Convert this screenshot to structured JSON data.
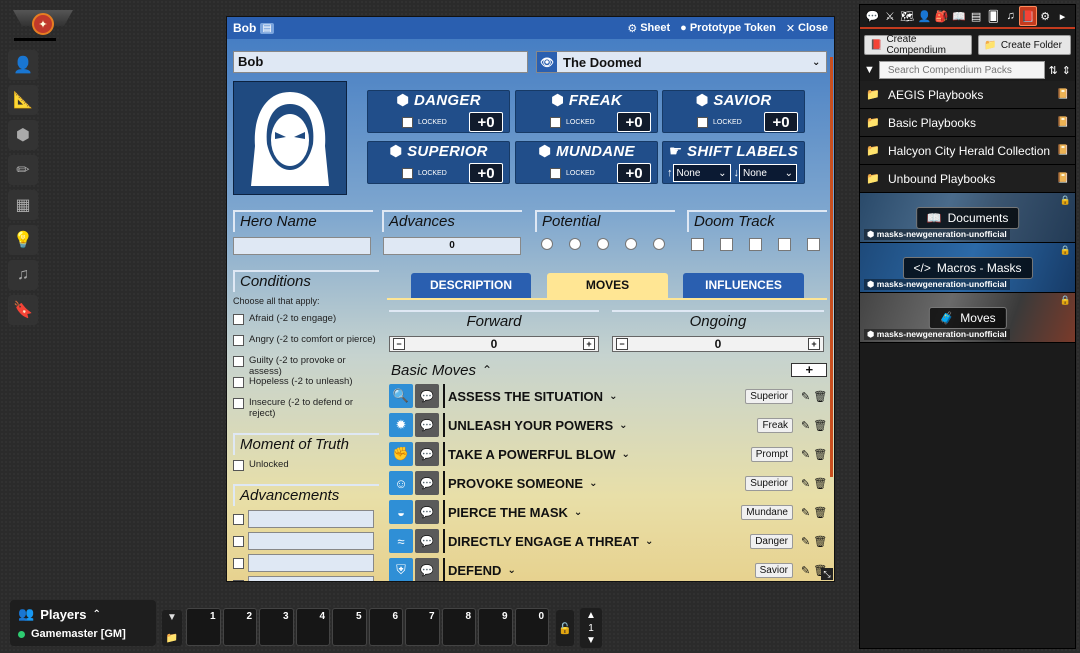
{
  "left_tools": [
    "token-controls",
    "measure",
    "tiles",
    "drawing",
    "walls",
    "lighting",
    "sounds",
    "notes"
  ],
  "players": {
    "title": "Players",
    "gm": "Gamemaster [GM]"
  },
  "hotbar": {
    "slots": [
      "1",
      "2",
      "3",
      "4",
      "5",
      "6",
      "7",
      "8",
      "9",
      "0"
    ],
    "page": "1"
  },
  "sheet": {
    "title": "Bob",
    "actions": {
      "sheet": "Sheet",
      "token": "Prototype Token",
      "close": "Close"
    },
    "name": "Bob",
    "playbook": "The Doomed",
    "stats": [
      {
        "name": "DANGER",
        "locked": "LOCKED",
        "value": "+0"
      },
      {
        "name": "FREAK",
        "locked": "LOCKED",
        "value": "+0"
      },
      {
        "name": "SAVIOR",
        "locked": "LOCKED",
        "value": "+0"
      },
      {
        "name": "SUPERIOR",
        "locked": "LOCKED",
        "value": "+0"
      },
      {
        "name": "MUNDANE",
        "locked": "LOCKED",
        "value": "+0"
      }
    ],
    "shift_labels": {
      "name": "SHIFT LABELS",
      "up": "None",
      "down": "None"
    },
    "hero_name_label": "Hero Name",
    "advances_label": "Advances",
    "advances_value": "0",
    "potential_label": "Potential",
    "doom_track_label": "Doom Track",
    "conditions_label": "Conditions",
    "conditions_sub": "Choose all that apply:",
    "conditions": [
      "Afraid (-2 to engage)",
      "Angry (-2 to comfort or pierce)",
      "Guilty (-2 to provoke or assess)",
      "Hopeless (-2 to unleash)",
      "Insecure (-2 to defend or reject)"
    ],
    "moment_label": "Moment of Truth",
    "moment_unlocked": "Unlocked",
    "advancements_label": "Advancements",
    "tabs": [
      "DESCRIPTION",
      "MOVES",
      "INFLUENCES"
    ],
    "forward_label": "Forward",
    "forward_value": "0",
    "ongoing_label": "Ongoing",
    "ongoing_value": "0",
    "basic_moves_label": "Basic Moves",
    "add_label": "+",
    "moves": [
      {
        "name": "ASSESS THE SITUATION",
        "tag": "Superior",
        "icon": "magnifier-icon"
      },
      {
        "name": "UNLEASH YOUR POWERS",
        "tag": "Freak",
        "icon": "burst-icon"
      },
      {
        "name": "TAKE A POWERFUL BLOW",
        "tag": "Prompt",
        "icon": "fist-icon"
      },
      {
        "name": "PROVOKE SOMEONE",
        "tag": "Superior",
        "icon": "crowd-icon"
      },
      {
        "name": "PIERCE THE MASK",
        "tag": "Mundane",
        "icon": "mask-icon"
      },
      {
        "name": "DIRECTLY ENGAGE A THREAT",
        "tag": "Danger",
        "icon": "wave-icon"
      },
      {
        "name": "DEFEND",
        "tag": "Savior",
        "icon": "shield-icon"
      }
    ]
  },
  "sidebar": {
    "create_compendium": "Create Compendium",
    "create_folder": "Create Folder",
    "search_placeholder": "Search Compendium Packs",
    "folders": [
      "AEGIS Playbooks",
      "Basic Playbooks",
      "Halcyon City Herald Collection Pl",
      "Unbound Playbooks"
    ],
    "packs": [
      {
        "name": "Documents",
        "source": "masks-newgeneration-unofficial"
      },
      {
        "name": "Macros - Masks",
        "source": "masks-newgeneration-unofficial"
      },
      {
        "name": "Moves",
        "source": "masks-newgeneration-unofficial"
      }
    ]
  },
  "colors": {
    "accent": "#2a5fb0",
    "active_tab": "#ffe694",
    "sidebar_active": "#c43b1e"
  }
}
